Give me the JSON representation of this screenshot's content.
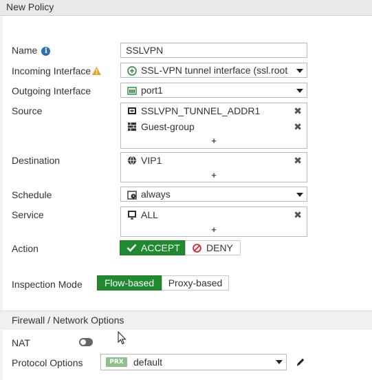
{
  "window": {
    "title": "New Policy"
  },
  "form": {
    "name": {
      "label": "Name",
      "value": "SSLVPN"
    },
    "incoming": {
      "label": "Incoming Interface",
      "value": "SSL-VPN tunnel interface (ssl.root"
    },
    "outgoing": {
      "label": "Outgoing Interface",
      "value": "port1"
    },
    "source": {
      "label": "Source",
      "items": [
        "SSLVPN_TUNNEL_ADDR1",
        "Guest-group"
      ],
      "add": "+"
    },
    "destination": {
      "label": "Destination",
      "items": [
        "VIP1"
      ],
      "add": "+"
    },
    "schedule": {
      "label": "Schedule",
      "value": "always"
    },
    "service": {
      "label": "Service",
      "items": [
        "ALL"
      ],
      "add": "+"
    },
    "action": {
      "label": "Action",
      "accept": "ACCEPT",
      "deny": "DENY",
      "selected": "ACCEPT"
    },
    "inspection": {
      "label": "Inspection Mode",
      "flow": "Flow-based",
      "proxy": "Proxy-based",
      "selected": "Flow-based"
    }
  },
  "firewall_section": {
    "title": "Firewall / Network Options",
    "nat": {
      "label": "NAT",
      "enabled": false
    },
    "protocol_options": {
      "label": "Protocol Options",
      "badge": "PRX",
      "value": "default"
    }
  },
  "icons": {
    "remove": "✖"
  },
  "colors": {
    "accent_green": "#1f8a2e",
    "info_blue": "#2d6fb3",
    "warning_orange": "#f0a020",
    "deny_red": "#d9232d"
  }
}
